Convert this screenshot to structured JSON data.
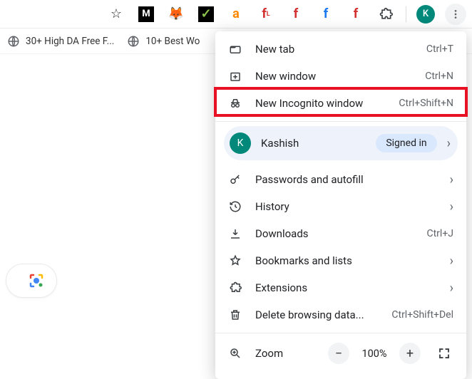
{
  "toolbar": {
    "avatar_letter": "K"
  },
  "bookmarks": {
    "item1": "30+ High DA Free F...",
    "item2": "10+ Best Wo"
  },
  "menu": {
    "new_tab": {
      "label": "New tab",
      "accel": "Ctrl+T"
    },
    "new_window": {
      "label": "New window",
      "accel": "Ctrl+N"
    },
    "incognito": {
      "label": "New Incognito window",
      "accel": "Ctrl+Shift+N"
    },
    "profile": {
      "name": "Kashish",
      "status": "Signed in",
      "avatar_letter": "K"
    },
    "passwords": {
      "label": "Passwords and autofill"
    },
    "history": {
      "label": "History"
    },
    "downloads": {
      "label": "Downloads",
      "accel": "Ctrl+J"
    },
    "bookmarks": {
      "label": "Bookmarks and lists"
    },
    "extensions": {
      "label": "Extensions"
    },
    "clear": {
      "label": "Delete browsing data...",
      "accel": "Ctrl+Shift+Del"
    },
    "zoom": {
      "label": "Zoom",
      "pct": "100%"
    }
  }
}
